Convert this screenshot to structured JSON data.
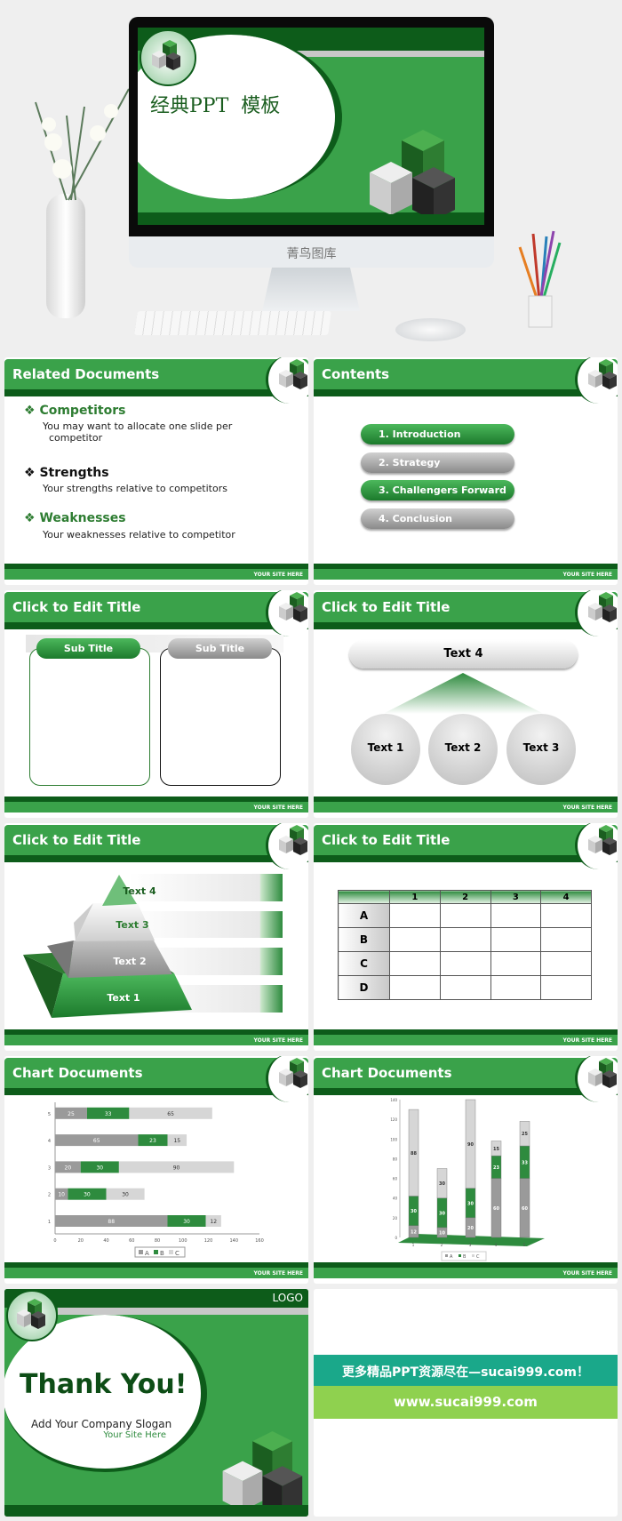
{
  "hero": {
    "title": "经典PPT  模板",
    "monitor_brand": "菁鸟图库"
  },
  "footer_text": "YOUR SITE HERE",
  "slides": {
    "related": {
      "title": "Related Documents",
      "items": [
        {
          "heading": "Competitors",
          "desc": "You may want to allocate one slide per",
          "desc2": "competitor",
          "color": "#2e7d32"
        },
        {
          "heading": "Strengths",
          "desc": "Your strengths relative to competitors",
          "color": "#111111"
        },
        {
          "heading": "Weaknesses",
          "desc": "Your weaknesses relative to competitor",
          "color": "#2e7d32"
        }
      ]
    },
    "contents": {
      "title": "Contents",
      "items": [
        "1. Introduction",
        "2. Strategy",
        "3. Challengers Forward",
        "4. Conclusion"
      ]
    },
    "subtitles": {
      "title": "Click to Edit Title",
      "sub1": "Sub Title",
      "sub2": "Sub Title"
    },
    "hierarchy": {
      "title": "Click to Edit Title",
      "top": "Text 4",
      "items": [
        "Text 1",
        "Text 2",
        "Text 3"
      ]
    },
    "pyramid": {
      "title": "Click to Edit Title",
      "levels": [
        "Text 1",
        "Text 2",
        "Text 3",
        "Text 4"
      ]
    },
    "table": {
      "title": "Click to Edit Title",
      "columns": [
        "1",
        "2",
        "3",
        "4"
      ],
      "rows": [
        "A",
        "B",
        "C",
        "D"
      ]
    },
    "chart1": {
      "title": "Chart Documents"
    },
    "chart2": {
      "title": "Chart Documents"
    },
    "thanks": {
      "logo": "LOGO",
      "title": "Thank You!",
      "slogan": "Add Your Company Slogan",
      "site": "Your Site Here"
    },
    "promo": {
      "line1": "更多精品PPT资源尽在—sucai999.com！",
      "line2": "www.sucai999.com"
    }
  },
  "colors": {
    "green": "#3aa24a",
    "dark_green": "#0d5c1a",
    "gray": "#9e9e9e",
    "teal": "#1aa88a",
    "lime": "#8fd14f"
  },
  "chart_data": [
    {
      "type": "bar",
      "orientation": "horizontal",
      "stacked": true,
      "categories": [
        "1",
        "2",
        "3",
        "4",
        "5"
      ],
      "series": [
        {
          "name": "A",
          "values": [
            88,
            10,
            20,
            65,
            25
          ]
        },
        {
          "name": "B",
          "values": [
            30,
            30,
            30,
            23,
            33
          ]
        },
        {
          "name": "C",
          "values": [
            12,
            30,
            90,
            15,
            65
          ]
        }
      ],
      "xlim": [
        0,
        160
      ],
      "xticks": [
        0,
        20,
        40,
        60,
        80,
        100,
        120,
        140,
        160
      ],
      "legend": "bottom"
    },
    {
      "type": "bar",
      "orientation": "vertical",
      "stacked": true,
      "categories": [
        "1",
        "2",
        "3",
        "4",
        "5"
      ],
      "series": [
        {
          "name": "A",
          "values": [
            12,
            10,
            20,
            60,
            60
          ]
        },
        {
          "name": "B",
          "values": [
            30,
            30,
            30,
            23,
            33
          ]
        },
        {
          "name": "C",
          "values": [
            88,
            30,
            90,
            15,
            25
          ]
        }
      ],
      "ylim": [
        0,
        140
      ],
      "yticks": [
        0,
        20,
        40,
        60,
        80,
        100,
        120,
        140
      ],
      "legend": "bottom"
    }
  ]
}
